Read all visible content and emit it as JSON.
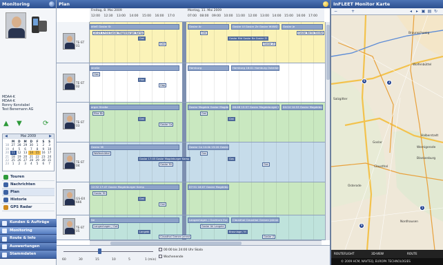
{
  "sidebar": {
    "title": "Monitoring",
    "driver": {
      "lines": [
        "MDA4-K",
        "MDA4-K",
        "Ronny Konstabel",
        "Test Benemann AG"
      ]
    },
    "calendar": {
      "month": "Mai 2009",
      "weekday_headers": [
        "",
        "M",
        "D",
        "M",
        "D",
        "F",
        "S",
        "S"
      ],
      "rows": [
        [
          "18",
          "27",
          "28",
          "29",
          "30",
          "1",
          "2",
          "3"
        ],
        [
          "19",
          "4",
          "5",
          "6",
          "7",
          "8",
          "9",
          "10"
        ],
        [
          "20",
          "11",
          "12",
          "13",
          "14",
          "15",
          "16",
          "17"
        ],
        [
          "21",
          "18",
          "19",
          "20",
          "21",
          "22",
          "23",
          "24"
        ],
        [
          "22",
          "25",
          "26",
          "27",
          "28",
          "29",
          "30",
          "31"
        ],
        [
          "23",
          "1",
          "2",
          "3",
          "4",
          "5",
          "6",
          "7"
        ]
      ]
    },
    "nav": [
      {
        "label": "Touren",
        "icon": "truck-icon",
        "color": "#2e9a3a"
      },
      {
        "label": "Nachrichten",
        "icon": "message-icon",
        "color": "#3d62a3"
      },
      {
        "label": "Plan",
        "icon": "plan-icon",
        "color": "#3d62a3"
      },
      {
        "label": "Historie",
        "icon": "history-icon",
        "color": "#3d62a3"
      },
      {
        "label": "GPS Radar",
        "icon": "radar-icon",
        "color": "#d08a1e"
      }
    ],
    "sections": [
      {
        "label": "Kunden & Aufträge"
      },
      {
        "label": "Monitoring"
      },
      {
        "label": "Route & Info"
      },
      {
        "label": "Auswertungen"
      },
      {
        "label": "Stammdaten"
      }
    ]
  },
  "plan": {
    "title": "Plan",
    "day1": "Freitag, 8. Mai 2009",
    "day2": "Montag, 11. Mai 2009",
    "hours1": [
      "12:00",
      "12:30",
      "13:00",
      "14:00",
      "15:00",
      "16:00",
      "17:0"
    ],
    "hours2": [
      "07:00",
      "08:00",
      "09:00",
      "10:00",
      "11:00",
      "12:00",
      "13:00",
      "14:00",
      "15:00",
      "16:00",
      "17:00"
    ],
    "rows": [
      {
        "id": "TE-ST 01",
        "bg": "#fbf3b8",
        "bands": [
          "alteE  Goslar St",
          "Goslar Ar",
          "Goslar Ul  Goslar Ze  Goslar W4W2 R  Goslar Zi  13:13 Goslar Zirkzeger",
          "Goslar Je"
        ],
        "chips": [
          "10:23 17:04 Goslar Magdeburger Kamp",
          "Gmi",
          "Gmi",
          "Gmi",
          "Goslar Mid  Goslar Ba  Goslar Zi",
          "Goslar Zi",
          "Goslar Berlin Straße"
        ]
      },
      {
        "id": "TE-ST 02",
        "bg": "#ffffff",
        "bands": [
          "straße",
          "Hamburg",
          "Hamburg 16:01 Hamburg Osterbekstraße"
        ],
        "chips": [
          "Han",
          "Han",
          "Hap"
        ]
      },
      {
        "id": "TE-ST 03",
        "bg": "#c9e8c0",
        "bands": [
          "arger Straße",
          "Goslar Magdeb  Goslar Magdeburger Kamp",
          "06:48 15:57 Goslar Magdeburger Kamp",
          "04:14 10:53 Goslar Magdeburger Kamp"
        ],
        "chips": [
          "Elbe Bk",
          "Gmi",
          "Goslar Ca",
          "Gmi",
          "Gmi"
        ]
      },
      {
        "id": "TE-ST 04",
        "bg": "#c6dcea",
        "bands": [
          "Goslar Mi",
          "Goslar Ca  14:4k 15:20 Goslar Am Stollen"
        ],
        "chips": [
          "Wolfenbüttel",
          "Goslar 17:45 Goslar Magdeburger Kamp",
          "Goslar Mi",
          "Gos",
          "Gos",
          "Gos"
        ]
      },
      {
        "id": "GS-EX 666",
        "bg": "#c9e8c0",
        "bands": [
          "12:32 17:47 Goslar Magdeburger Kamp",
          "07:51 16:07 Goslar Magdeburger Kamp"
        ],
        "chips": [
          "Goslar Mi",
          "Gmi",
          "Gmi"
        ]
      },
      {
        "id": "TE-ST 05",
        "bg": "#bfe3dc",
        "bands": [
          "Ne",
          "Langenhagen / Gochtum Eur  Langebi",
          "Clausthal  Clausthal  Grenen Jahnst  Goslar Ak  Langehagen  Braunlage / H  Harz Ch"
        ],
        "chips": [
          "Langenhagen / Got",
          "Langebi",
          "Clausthal  Grenen Jahnst",
          "Goslar Ak  Langebi",
          "Braunlage / H",
          "Goslar Z"
        ]
      }
    ],
    "zoom_labels": [
      "60",
      "30",
      "15",
      "10",
      "5",
      "1 (min)"
    ],
    "options": [
      "00:00 bis 24:00 Uhr Skala",
      "Wochenende"
    ]
  },
  "map": {
    "title": "InFLEET Monitor Karte",
    "places": [
      "Braunschweig",
      "Salzgitter",
      "Goslar",
      "Wolfenbüttel",
      "Clausthal",
      "Halberstadt",
      "Blankenburg",
      "Wernigerode",
      "Nordhausen",
      "Osterode"
    ],
    "markers": [
      "6",
      "3",
      "9",
      "5"
    ],
    "bottom_items": [
      "ROUTEFLIGHT",
      "3D-VIEW",
      "ROUTE"
    ],
    "copyright": "© 2009 HCM, NAVTEQ, EUROPA TECHNOLOGIES"
  }
}
